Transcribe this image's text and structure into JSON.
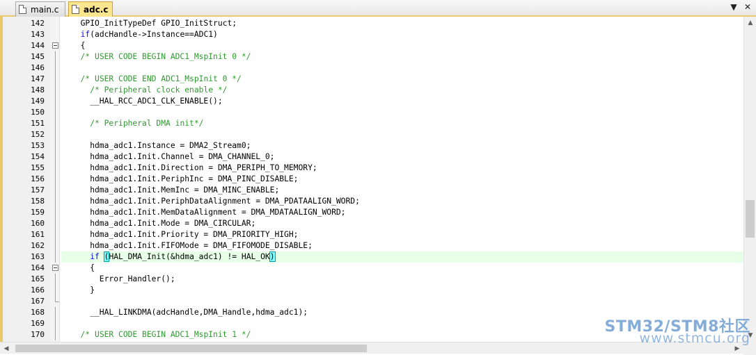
{
  "tabs": [
    {
      "label": "main.c",
      "active": false
    },
    {
      "label": "adc.c",
      "active": true
    }
  ],
  "tab_controls": {
    "dropdown_icon": "chevron-down-icon",
    "close_icon": "close-icon"
  },
  "colors": {
    "comment": "#2e9a2e",
    "keyword": "#0000ff",
    "current_line": "#e8ffe8",
    "brace_match": "#7fffff"
  },
  "editor": {
    "current_line": 163,
    "lines": [
      {
        "n": "142",
        "fold": "",
        "segs": [
          [
            "  GPIO_InitTypeDef GPIO_InitStruct;",
            ""
          ]
        ]
      },
      {
        "n": "143",
        "fold": "",
        "segs": [
          [
            "  ",
            ""
          ],
          [
            "if",
            "kw"
          ],
          [
            "(adcHandle->Instance==ADC1)",
            ""
          ]
        ]
      },
      {
        "n": "144",
        "fold": "open",
        "segs": [
          [
            "  {",
            ""
          ]
        ]
      },
      {
        "n": "145",
        "fold": "line",
        "segs": [
          [
            "  ",
            ""
          ],
          [
            "/* USER CODE BEGIN ADC1_MspInit 0 */",
            "cm"
          ]
        ]
      },
      {
        "n": "146",
        "fold": "line",
        "segs": [
          [
            "",
            ""
          ]
        ]
      },
      {
        "n": "147",
        "fold": "line",
        "segs": [
          [
            "  ",
            ""
          ],
          [
            "/* USER CODE END ADC1_MspInit 0 */",
            "cm"
          ]
        ]
      },
      {
        "n": "148",
        "fold": "line",
        "segs": [
          [
            "    ",
            ""
          ],
          [
            "/* Peripheral clock enable */",
            "cm"
          ]
        ]
      },
      {
        "n": "149",
        "fold": "line",
        "segs": [
          [
            "    __HAL_RCC_ADC1_CLK_ENABLE();",
            ""
          ]
        ]
      },
      {
        "n": "150",
        "fold": "line",
        "segs": [
          [
            "",
            ""
          ]
        ]
      },
      {
        "n": "151",
        "fold": "line",
        "segs": [
          [
            "    ",
            ""
          ],
          [
            "/* Peripheral DMA init*/",
            "cm"
          ]
        ]
      },
      {
        "n": "152",
        "fold": "line",
        "segs": [
          [
            "",
            ""
          ]
        ]
      },
      {
        "n": "153",
        "fold": "line",
        "segs": [
          [
            "    hdma_adc1.Instance = DMA2_Stream0;",
            ""
          ]
        ]
      },
      {
        "n": "154",
        "fold": "line",
        "segs": [
          [
            "    hdma_adc1.Init.Channel = DMA_CHANNEL_0;",
            ""
          ]
        ]
      },
      {
        "n": "155",
        "fold": "line",
        "segs": [
          [
            "    hdma_adc1.Init.Direction = DMA_PERIPH_TO_MEMORY;",
            ""
          ]
        ]
      },
      {
        "n": "156",
        "fold": "line",
        "segs": [
          [
            "    hdma_adc1.Init.PeriphInc = DMA_PINC_DISABLE;",
            ""
          ]
        ]
      },
      {
        "n": "157",
        "fold": "line",
        "segs": [
          [
            "    hdma_adc1.Init.MemInc = DMA_MINC_ENABLE;",
            ""
          ]
        ]
      },
      {
        "n": "158",
        "fold": "line",
        "segs": [
          [
            "    hdma_adc1.Init.PeriphDataAlignment = DMA_PDATAALIGN_WORD;",
            ""
          ]
        ]
      },
      {
        "n": "159",
        "fold": "line",
        "segs": [
          [
            "    hdma_adc1.Init.MemDataAlignment = DMA_MDATAALIGN_WORD;",
            ""
          ]
        ]
      },
      {
        "n": "160",
        "fold": "line",
        "segs": [
          [
            "    hdma_adc1.Init.Mode = DMA_CIRCULAR;",
            ""
          ]
        ]
      },
      {
        "n": "161",
        "fold": "line",
        "segs": [
          [
            "    hdma_adc1.Init.Priority = DMA_PRIORITY_HIGH;",
            ""
          ]
        ]
      },
      {
        "n": "162",
        "fold": "line",
        "segs": [
          [
            "    hdma_adc1.Init.FIFOMode = DMA_FIFOMODE_DISABLE;",
            ""
          ]
        ]
      },
      {
        "n": "163",
        "fold": "line",
        "segs": [
          [
            "    ",
            ""
          ],
          [
            "if",
            "kw"
          ],
          [
            " ",
            ""
          ],
          [
            "(",
            "brace"
          ],
          [
            "HAL_DMA_Init(&hdma_adc1) != HAL_OK",
            ""
          ],
          [
            ")",
            "brace"
          ]
        ]
      },
      {
        "n": "164",
        "fold": "open",
        "segs": [
          [
            "    {",
            ""
          ]
        ]
      },
      {
        "n": "165",
        "fold": "line",
        "segs": [
          [
            "      Error_Handler();",
            ""
          ]
        ]
      },
      {
        "n": "166",
        "fold": "line",
        "segs": [
          [
            "    }",
            ""
          ]
        ]
      },
      {
        "n": "167",
        "fold": "end",
        "segs": [
          [
            "",
            ""
          ]
        ]
      },
      {
        "n": "168",
        "fold": "line",
        "segs": [
          [
            "    __HAL_LINKDMA(adcHandle,DMA_Handle,hdma_adc1);",
            ""
          ]
        ]
      },
      {
        "n": "169",
        "fold": "line",
        "segs": [
          [
            "",
            ""
          ]
        ]
      },
      {
        "n": "170",
        "fold": "line",
        "segs": [
          [
            "  ",
            ""
          ],
          [
            "/* USER CODE BEGIN ADC1_MspInit 1 */",
            "cm"
          ]
        ]
      }
    ]
  },
  "watermark": {
    "title": "STM32/STM8社区",
    "url": "www.stmcu.org"
  }
}
